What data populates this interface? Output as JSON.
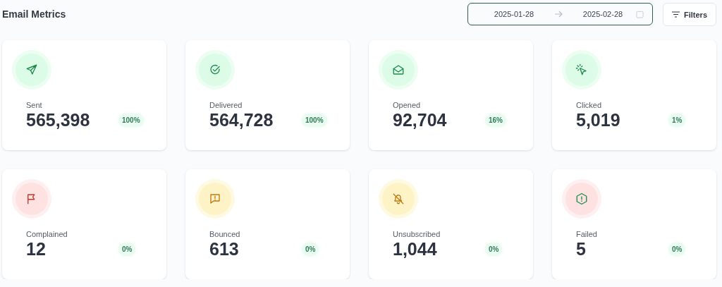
{
  "header": {
    "title": "Email Metrics",
    "date_range": {
      "start": "2025-01-28",
      "end": "2025-02-28"
    },
    "filters_button": "Filters"
  },
  "metrics": [
    {
      "kind": "send",
      "color": "#dcfce7",
      "label": "Sent",
      "value": "565,398",
      "percent": "100%"
    },
    {
      "kind": "check",
      "color": "#dcfce7",
      "label": "Delivered",
      "value": "564,728",
      "percent": "100%"
    },
    {
      "kind": "mail",
      "color": "#dcfce7",
      "label": "Opened",
      "value": "92,704",
      "percent": "16%"
    },
    {
      "kind": "click",
      "color": "#dcfce7",
      "label": "Clicked",
      "value": "5,019",
      "percent": "1%"
    },
    {
      "kind": "flag",
      "color": "#fee2e2",
      "label": "Complained",
      "value": "12",
      "percent": "0%"
    },
    {
      "kind": "message-alert",
      "color": "#fef3c7",
      "label": "Bounced",
      "value": "613",
      "percent": "0%"
    },
    {
      "kind": "bell-off",
      "color": "#fef3c7",
      "label": "Unsubscribed",
      "value": "1,044",
      "percent": "0%"
    },
    {
      "kind": "hex-alert",
      "color": "#fee2e2",
      "label": "Failed",
      "value": "5",
      "percent": "0%"
    }
  ]
}
